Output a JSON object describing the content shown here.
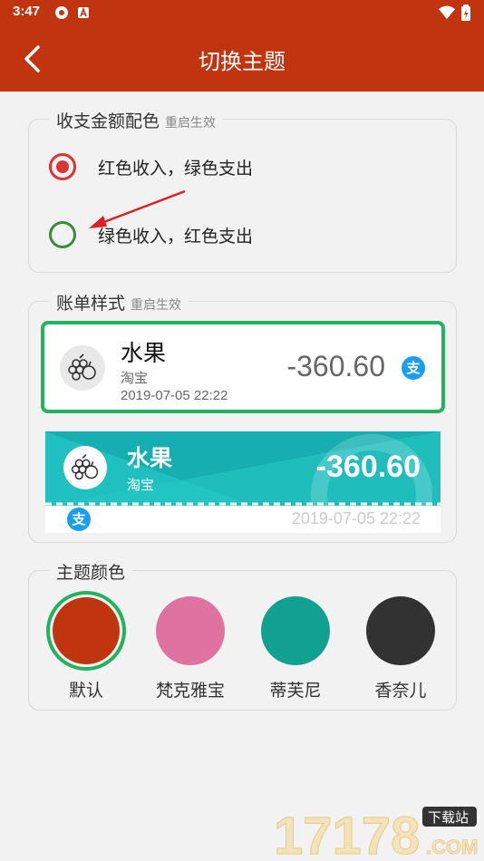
{
  "status_bar": {
    "time": "3:47"
  },
  "app_bar": {
    "title": "切换主题"
  },
  "amount_color": {
    "legend": "收支金额配色",
    "note": "重启生效",
    "options": [
      {
        "label": "红色收入，绿色支出",
        "checked": true
      },
      {
        "label": "绿色收入，红色支出",
        "checked": false
      }
    ]
  },
  "bill_style": {
    "legend": "账单样式",
    "note": "重启生效",
    "style1": {
      "name": "水果",
      "source": "淘宝",
      "date": "2019-07-05 22:22",
      "amount": "-360.60",
      "pay_icon": "支"
    },
    "style2": {
      "name": "水果",
      "source": "淘宝",
      "date": "2019-07-05 22:22",
      "amount": "-360.60",
      "pay_icon": "支"
    }
  },
  "theme_color": {
    "legend": "主题颜色",
    "colors": [
      {
        "label": "默认",
        "hex": "#c0350f",
        "selected": true
      },
      {
        "label": "梵克雅宝",
        "hex": "#e0729f",
        "selected": false
      },
      {
        "label": "蒂芙尼",
        "hex": "#12a090",
        "selected": false
      },
      {
        "label": "香奈儿",
        "hex": "#323232",
        "selected": false
      }
    ]
  },
  "watermark": {
    "text": "17178",
    "badge": "下载站",
    "suffix": ".COM"
  }
}
